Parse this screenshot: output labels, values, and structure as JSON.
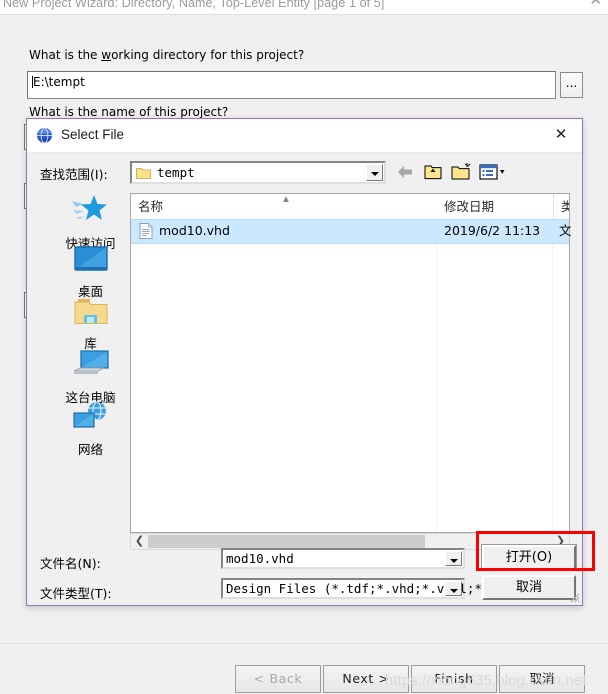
{
  "wizard": {
    "title": "New Project Wizard: Directory, Name, Top-Level Entity [page 1 of 5]",
    "close_icon": "close-icon",
    "question_working_dir_pre": "What is the ",
    "question_working_dir_accel": "w",
    "question_working_dir_post": "orking directory for this project?",
    "working_dir_value": "E:\\tempt",
    "browse_label": "...",
    "question_project_name": "What is the name of this project?",
    "buttons": {
      "back": "< Back",
      "next": "Next >",
      "finish": "Finish",
      "cancel": "取消"
    },
    "watermark": "https://xiong535.blog.csdn.net"
  },
  "select_file": {
    "title": "Select File",
    "app_icon": "globe-icon",
    "close_icon": "close-icon",
    "look_in_label": "查找范围(I):",
    "look_in_value": "tempt",
    "toolbar": {
      "back_icon": "back-arrow-icon",
      "up_icon": "up-folder-icon",
      "new_folder_icon": "new-folder-icon",
      "views_icon": "views-icon"
    },
    "places": [
      {
        "label": "快速访问",
        "icon": "quick-access-star-icon"
      },
      {
        "label": "桌面",
        "icon": "desktop-monitor-icon"
      },
      {
        "label": "库",
        "icon": "library-folder-icon"
      },
      {
        "label": "这台电脑",
        "icon": "this-pc-icon"
      },
      {
        "label": "网络",
        "icon": "network-icon"
      }
    ],
    "columns": [
      "名称",
      "修改日期",
      "类"
    ],
    "rows": [
      {
        "name": "mod10.vhd",
        "modified": "2019/6/2 11:13",
        "type": "文",
        "icon": "document-icon",
        "selected": true
      }
    ],
    "file_name_label": "文件名(N):",
    "file_name_value": "mod10.vhd",
    "file_type_label": "文件类型(T):",
    "file_type_value": "Design Files (*.tdf;*.vhd;*.vhdl;*.v;",
    "open_button": "打开(O)",
    "cancel_button": "取消",
    "scroll_left_icon": "chevron-left-icon",
    "scroll_right_icon": "chevron-right-icon",
    "sort_indicator": "▲"
  },
  "colors": {
    "dialog_border": "#9575b5",
    "selection": "#cce8ff",
    "highlight_box": "#ff0000",
    "face": "#f0f0f0"
  }
}
